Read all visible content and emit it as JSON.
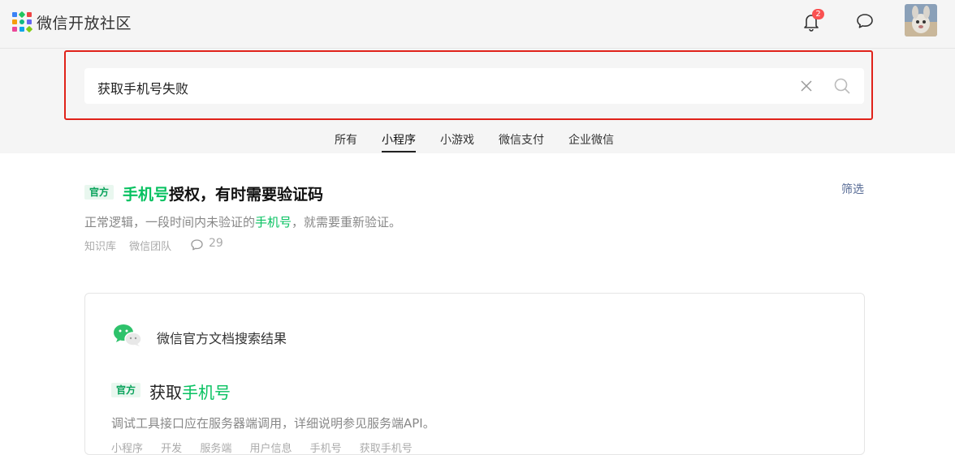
{
  "header": {
    "brand": "微信开放社区",
    "notification_count": "2",
    "icons": [
      "logo-icon",
      "bell-icon",
      "message-icon",
      "avatar"
    ]
  },
  "search": {
    "value": "获取手机号失败",
    "clear_icon": "close-icon",
    "search_icon": "search-icon"
  },
  "tabs": [
    {
      "label": "所有",
      "active": false
    },
    {
      "label": "小程序",
      "active": true
    },
    {
      "label": "小游戏",
      "active": false
    },
    {
      "label": "微信支付",
      "active": false
    },
    {
      "label": "企业微信",
      "active": false
    }
  ],
  "results": [
    {
      "badge": "官方",
      "title_highlight": "手机号",
      "title_rest": "授权，有时需要验证码",
      "desc_before": "正常逻辑，一段时间内未验证的",
      "desc_highlight": "手机号",
      "desc_after": "，就需要重新验证。",
      "meta": [
        "知识库",
        "微信团队"
      ],
      "comment_count": "29"
    }
  ],
  "filter_label": "筛选",
  "official_docs": {
    "heading": "微信官方文档搜索结果",
    "item": {
      "badge": "官方",
      "title_before": "获取",
      "title_highlight": "手机号",
      "desc": "调试工具接口应在服务器端调用，详细说明参见服务端API。",
      "tags": [
        "小程序",
        "开发",
        "服务端",
        "用户信息",
        "手机号",
        "获取手机号"
      ]
    }
  },
  "colors": {
    "accent_green": "#07c160",
    "link_blue": "#576b95",
    "badge_red": "#fa5151",
    "highlight_border": "#e0221a"
  }
}
